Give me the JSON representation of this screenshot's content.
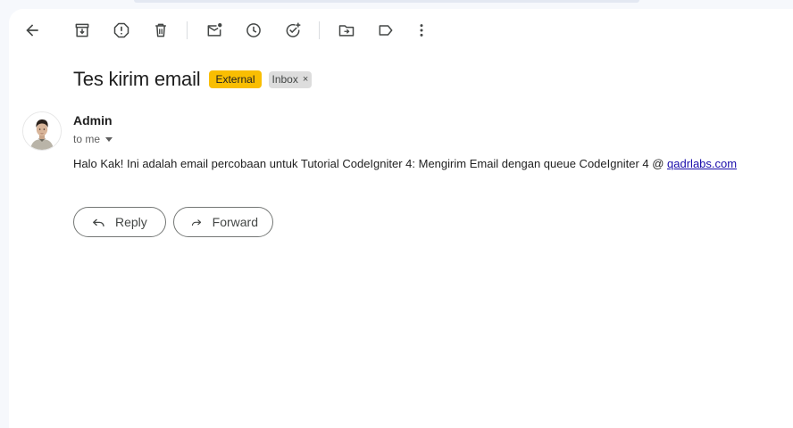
{
  "toolbar": {
    "icons": [
      "back-arrow-icon",
      "archive-icon",
      "report-spam-icon",
      "delete-icon",
      "mark-unread-icon",
      "snooze-icon",
      "add-to-tasks-icon",
      "move-to-icon",
      "label-icon",
      "more-vert-icon"
    ]
  },
  "email": {
    "subject": "Tes kirim email",
    "labels": {
      "external": "External",
      "inbox": "Inbox",
      "remove_symbol": "×"
    },
    "sender_name": "Admin",
    "recipient_line": "to me",
    "body_text": "Halo Kak! Ini adalah email percobaan untuk Tutorial CodeIgniter 4: Mengirim Email dengan queue CodeIgniter 4 @ ",
    "body_link": "qadrlabs.com"
  },
  "actions": {
    "reply_label": "Reply",
    "forward_label": "Forward"
  },
  "colors": {
    "external_badge": "#f9be02",
    "inbox_badge": "#dddddd",
    "link": "#1a0dab",
    "background": "#f6f8fc"
  }
}
